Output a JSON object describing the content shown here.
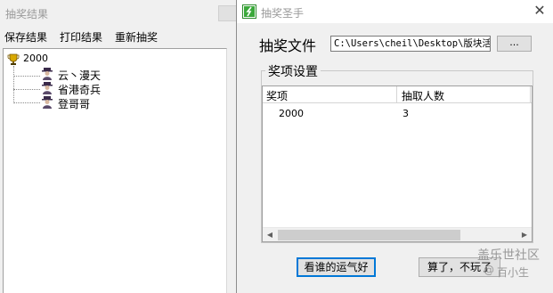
{
  "back_window": {
    "title": "抽奖结果",
    "menu": [
      "保存结果",
      "打印结果",
      "重新抽奖"
    ],
    "tree": {
      "root_label": "2000",
      "root_icon": "trophy-icon",
      "children": [
        "云丶漫天",
        "省港奇兵",
        "登哥哥"
      ],
      "child_icon": "person-icon"
    }
  },
  "dialog": {
    "title": "抽奖圣手",
    "close_symbol": "✕",
    "file_label": "抽奖文件",
    "file_path": "C:\\Users\\cheil\\Desktop\\版块活",
    "browse_label": "...",
    "group_title": "奖项设置",
    "list": {
      "columns": [
        "奖项",
        "抽取人数"
      ],
      "rows": [
        {
          "prize": "2000",
          "count": "3"
        }
      ]
    },
    "scroll_left": "◀",
    "scroll_right": "▶",
    "buttons": {
      "lucky": "看谁的运气好",
      "quit": "算了，不玩了"
    }
  },
  "watermark": {
    "main": "盖乐世社区",
    "at": "@",
    "sub": "百小生"
  },
  "colors": {
    "accent": "#0078d7",
    "window_bg": "#f0f0f0",
    "trophy": "#d8a800",
    "person": "#5a4a6a"
  }
}
